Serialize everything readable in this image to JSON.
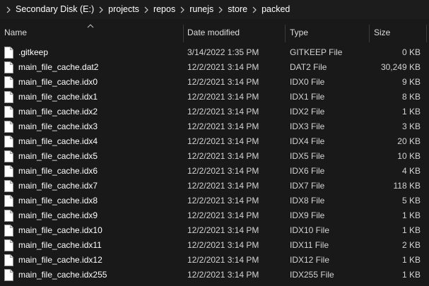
{
  "breadcrumb": [
    "Secondary Disk (E:)",
    "projects",
    "repos",
    "runejs",
    "store",
    "packed"
  ],
  "columns": {
    "name": "Name",
    "date": "Date modified",
    "type": "Type",
    "size": "Size"
  },
  "files": [
    {
      "name": ".gitkeep",
      "date": "3/14/2022 1:35 PM",
      "type": "GITKEEP File",
      "size": "0 KB"
    },
    {
      "name": "main_file_cache.dat2",
      "date": "12/2/2021 3:14 PM",
      "type": "DAT2 File",
      "size": "30,249 KB"
    },
    {
      "name": "main_file_cache.idx0",
      "date": "12/2/2021 3:14 PM",
      "type": "IDX0 File",
      "size": "9 KB"
    },
    {
      "name": "main_file_cache.idx1",
      "date": "12/2/2021 3:14 PM",
      "type": "IDX1 File",
      "size": "8 KB"
    },
    {
      "name": "main_file_cache.idx2",
      "date": "12/2/2021 3:14 PM",
      "type": "IDX2 File",
      "size": "1 KB"
    },
    {
      "name": "main_file_cache.idx3",
      "date": "12/2/2021 3:14 PM",
      "type": "IDX3 File",
      "size": "3 KB"
    },
    {
      "name": "main_file_cache.idx4",
      "date": "12/2/2021 3:14 PM",
      "type": "IDX4 File",
      "size": "20 KB"
    },
    {
      "name": "main_file_cache.idx5",
      "date": "12/2/2021 3:14 PM",
      "type": "IDX5 File",
      "size": "10 KB"
    },
    {
      "name": "main_file_cache.idx6",
      "date": "12/2/2021 3:14 PM",
      "type": "IDX6 File",
      "size": "4 KB"
    },
    {
      "name": "main_file_cache.idx7",
      "date": "12/2/2021 3:14 PM",
      "type": "IDX7 File",
      "size": "118 KB"
    },
    {
      "name": "main_file_cache.idx8",
      "date": "12/2/2021 3:14 PM",
      "type": "IDX8 File",
      "size": "5 KB"
    },
    {
      "name": "main_file_cache.idx9",
      "date": "12/2/2021 3:14 PM",
      "type": "IDX9 File",
      "size": "1 KB"
    },
    {
      "name": "main_file_cache.idx10",
      "date": "12/2/2021 3:14 PM",
      "type": "IDX10 File",
      "size": "1 KB"
    },
    {
      "name": "main_file_cache.idx11",
      "date": "12/2/2021 3:14 PM",
      "type": "IDX11 File",
      "size": "2 KB"
    },
    {
      "name": "main_file_cache.idx12",
      "date": "12/2/2021 3:14 PM",
      "type": "IDX12 File",
      "size": "1 KB"
    },
    {
      "name": "main_file_cache.idx255",
      "date": "12/2/2021 3:14 PM",
      "type": "IDX255 File",
      "size": "1 KB"
    }
  ],
  "sort": {
    "column": "name",
    "direction": "ascending"
  },
  "icons": {
    "separator": "chevron-right-icon",
    "sort": "sort-up-icon",
    "file": "file-icon"
  }
}
